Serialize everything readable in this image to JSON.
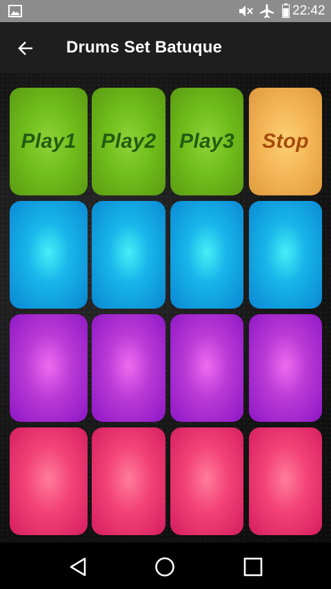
{
  "status_bar": {
    "time": "22:42",
    "icons": [
      "image-icon",
      "mute-icon",
      "airplane-mode-icon",
      "battery-icon"
    ]
  },
  "app_bar": {
    "title": "Drums Set Batuque",
    "back_icon": "back-arrow-icon"
  },
  "pads": {
    "rows": [
      [
        {
          "label": "Play1",
          "color": "green"
        },
        {
          "label": "Play2",
          "color": "green"
        },
        {
          "label": "Play3",
          "color": "green"
        },
        {
          "label": "Stop",
          "color": "orange"
        }
      ],
      [
        {
          "label": "",
          "color": "blue"
        },
        {
          "label": "",
          "color": "blue"
        },
        {
          "label": "",
          "color": "blue"
        },
        {
          "label": "",
          "color": "blue"
        }
      ],
      [
        {
          "label": "",
          "color": "purple"
        },
        {
          "label": "",
          "color": "purple"
        },
        {
          "label": "",
          "color": "purple"
        },
        {
          "label": "",
          "color": "purple"
        }
      ],
      [
        {
          "label": "",
          "color": "pink"
        },
        {
          "label": "",
          "color": "pink"
        },
        {
          "label": "",
          "color": "pink"
        },
        {
          "label": "",
          "color": "pink"
        }
      ]
    ],
    "colors": {
      "green": "#70be1c",
      "orange": "#f4b455",
      "blue": "#18b6ea",
      "purple": "#b83ad6",
      "pink": "#f34278"
    }
  },
  "nav_bar": {
    "icons": [
      "nav-back-icon",
      "nav-home-icon",
      "nav-recents-icon"
    ]
  }
}
